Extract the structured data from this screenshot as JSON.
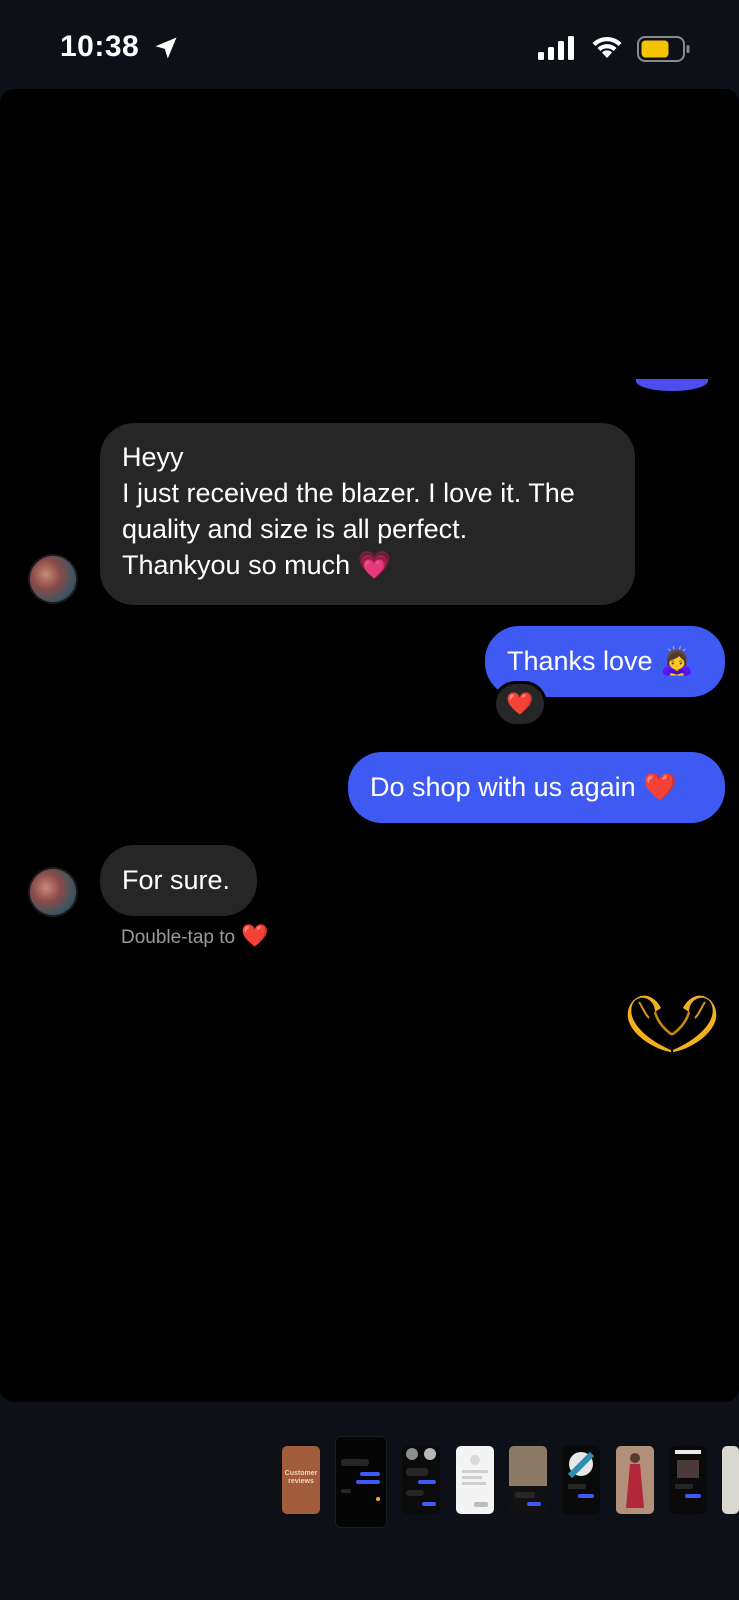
{
  "status_bar": {
    "time": "10:38",
    "location_icon": "location-arrow-icon",
    "signal_icon": "cellular-signal-icon",
    "wifi_icon": "wifi-icon",
    "battery_icon": "battery-low-power-icon"
  },
  "chat": {
    "messages": [
      {
        "direction": "incoming",
        "text": "Heyy\nI just received the blazer. I love it. The quality and size is all perfect.\nThankyou so much 💗"
      },
      {
        "direction": "outgoing",
        "text": "Thanks love 🙇‍♀️",
        "reaction": "❤️"
      },
      {
        "direction": "outgoing",
        "text": "Do shop with us again ❤️"
      },
      {
        "direction": "incoming",
        "text": "For sure."
      }
    ],
    "hint": {
      "text": "Double-tap to",
      "heart": "❤️"
    },
    "sticker": "🫶"
  },
  "tray": {
    "thumbnails": [
      {
        "label": "Customer reviews",
        "color": "#a05c3b"
      },
      {
        "label": "",
        "color": "#050505",
        "active": true
      },
      {
        "label": "",
        "color": "#0b0b0b"
      },
      {
        "label": "",
        "color": "#f4f4f4"
      },
      {
        "label": "",
        "color": "#6b5a48"
      },
      {
        "label": "",
        "color": "#0a0a0a"
      },
      {
        "label": "",
        "color": "#9b6b58"
      },
      {
        "label": "",
        "color": "#0a0a0a"
      },
      {
        "label": "",
        "color": "#d8d8d0"
      }
    ]
  },
  "colors": {
    "outgoing_bubble": "#3e5af2",
    "incoming_bubble": "#262626",
    "background": "#000000",
    "frame": "#0d1117",
    "battery_fill": "#f5c400"
  }
}
